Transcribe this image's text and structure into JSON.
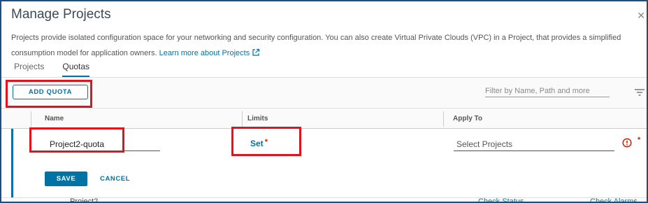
{
  "dialog": {
    "title": "Manage Projects",
    "close_icon": "close-icon",
    "description": "Projects provide isolated configuration space for your networking and security configuration. You can also create Virtual Private Clouds (VPC) in a Project, that provides a simplified consumption model for application owners.",
    "learn_more": "Learn more about Projects"
  },
  "tabs": [
    {
      "label": "Projects",
      "active": false
    },
    {
      "label": "Quotas",
      "active": true
    }
  ],
  "toolbar": {
    "add_quota_label": "ADD QUOTA",
    "filter_placeholder": "Filter by Name, Path and more",
    "filter_icon": "filter-icon"
  },
  "table": {
    "columns": [
      "Name",
      "Limits",
      "Apply To"
    ],
    "edit_row": {
      "name_value": "Project2-quota",
      "limits_link": "Set",
      "required_mark": "*",
      "apply_to_placeholder": "Select Projects",
      "error_icon": "error-icon",
      "save_label": "SAVE",
      "cancel_label": "CANCEL"
    },
    "partial_row": {
      "name": "Project2",
      "status_link": "Check Status",
      "alarms_link": "Check Alarms"
    }
  },
  "colors": {
    "accent": "#0072a3",
    "error": "#c92100",
    "highlight_box": "#e0141c"
  }
}
